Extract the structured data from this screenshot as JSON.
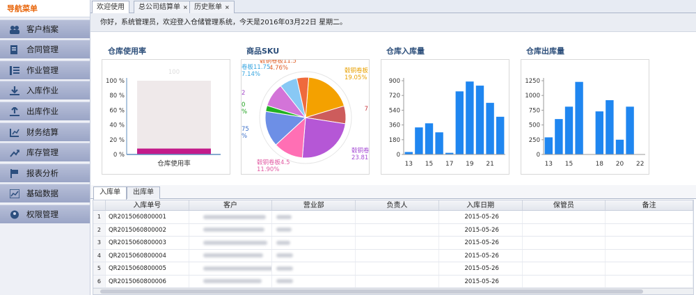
{
  "sidebar": {
    "title": "导航菜单",
    "items": [
      {
        "label": "客户档案",
        "icon": "users-icon"
      },
      {
        "label": "合同管理",
        "icon": "contract-icon"
      },
      {
        "label": "作业管理",
        "icon": "task-list-icon"
      },
      {
        "label": "入库作业",
        "icon": "inbound-icon"
      },
      {
        "label": "出库作业",
        "icon": "outbound-icon"
      },
      {
        "label": "财务结算",
        "icon": "finance-icon"
      },
      {
        "label": "库存管理",
        "icon": "inventory-icon"
      },
      {
        "label": "报表分析",
        "icon": "report-icon"
      },
      {
        "label": "基础数据",
        "icon": "data-icon"
      },
      {
        "label": "权限管理",
        "icon": "permission-icon"
      }
    ]
  },
  "tabs": [
    {
      "label": "欢迎使用",
      "closable": false
    },
    {
      "label": "总公司结算单",
      "closable": true
    },
    {
      "label": "历史账单",
      "closable": true
    }
  ],
  "close_glyph": "×",
  "greeting": "你好，系统管理员，欢迎登入仓储管理系统，今天是2016年03月22日   星期二。",
  "charts": [
    {
      "type": "bar",
      "title": "仓库使用率",
      "xlabel": "仓库使用率",
      "yticks": [
        "100 %",
        "80 %",
        "60 %",
        "40 %",
        "20 %",
        "0 %"
      ],
      "capacity_label": "100",
      "value_pct": 8,
      "bar_color": "#c31b8a"
    },
    {
      "type": "pie",
      "title": "商品SKU",
      "labels": [
        {
          "text": "毂铜卷板",
          "sub": "19.05%",
          "color": "#e8a000"
        },
        {
          "text": "7",
          "sub": "",
          "color": "#c8343c"
        },
        {
          "text": "毂铜卷",
          "sub": "23.81",
          "color": "#a54bd4"
        },
        {
          "text": "毂铜卷板4.5",
          "sub": "11.90%",
          "color": "#e15aa2"
        },
        {
          "text": "75",
          "sub": "%",
          "color": "#3b6fc8"
        },
        {
          "text": "0",
          "sub": "%",
          "color": "#1aa01a"
        },
        {
          "text": "2",
          "sub": "",
          "color": "#a347c7"
        },
        {
          "text": "卷板11.75",
          "sub": "7.14%",
          "color": "#37a5e0"
        },
        {
          "text": "毂铜卷板11.5",
          "sub": "4.76%",
          "color": "#e06028"
        }
      ]
    },
    {
      "type": "bar",
      "title": "仓库入库量",
      "yticks": [
        "900",
        "720",
        "540",
        "360",
        "180",
        "0"
      ],
      "xticks": [
        "13",
        "15",
        "17",
        "19",
        "21"
      ]
    },
    {
      "type": "bar",
      "title": "仓库出库量",
      "yticks": [
        "1250",
        "1000",
        "750",
        "500",
        "250",
        "0"
      ],
      "xticks": [
        "13",
        "15",
        "18",
        "20",
        "22"
      ]
    }
  ],
  "chart_data": [
    {
      "type": "bar",
      "title": "仓库使用率",
      "categories": [
        "仓库使用率"
      ],
      "values": [
        8
      ],
      "ylim": [
        0,
        100
      ],
      "capacity": 100
    },
    {
      "type": "pie",
      "title": "商品SKU",
      "slices": [
        {
          "name": "毂铜卷板",
          "value": 19.05,
          "color": "#f4a100"
        },
        {
          "name": "",
          "value": 7.14,
          "color": "#cd5c5c"
        },
        {
          "name": "毂铜卷",
          "value": 23.81,
          "color": "#b557d6"
        },
        {
          "name": "毂铜卷板4.5",
          "value": 11.9,
          "color": "#ff6fb4"
        },
        {
          "name": "",
          "value": 14.3,
          "color": "#6d8fe6"
        },
        {
          "name": "",
          "value": 2.38,
          "color": "#22b122"
        },
        {
          "name": "",
          "value": 9.52,
          "color": "#d374d8"
        },
        {
          "name": "卷板11.75",
          "value": 7.14,
          "color": "#88c8f4"
        },
        {
          "name": "毂铜卷板11.5",
          "value": 4.76,
          "color": "#ef6a3c"
        }
      ]
    },
    {
      "type": "bar",
      "title": "仓库入库量",
      "x": [
        13,
        14,
        15,
        16,
        17,
        18,
        19,
        20,
        21,
        22
      ],
      "values": [
        30,
        330,
        380,
        270,
        20,
        770,
        890,
        840,
        630,
        460
      ],
      "ylim": [
        0,
        900
      ]
    },
    {
      "type": "bar",
      "title": "仓库出库量",
      "x": [
        13,
        14,
        15,
        16,
        17,
        18,
        19,
        20,
        21,
        22
      ],
      "values": [
        290,
        600,
        810,
        1230,
        0,
        730,
        920,
        250,
        810
      ],
      "ylim": [
        0,
        1250
      ]
    }
  ],
  "bottom_tabs": [
    {
      "label": "入库单",
      "active": true
    },
    {
      "label": "出库单",
      "active": false
    }
  ],
  "table": {
    "columns": [
      "",
      "入库单号",
      "客户",
      "营业部",
      "负责人",
      "入库日期",
      "保管员",
      "备注"
    ],
    "rows": [
      {
        "no": "1",
        "id": "QR2015060800001",
        "date": "2015-05-26"
      },
      {
        "no": "2",
        "id": "QR2015060800002",
        "date": "2015-05-26"
      },
      {
        "no": "3",
        "id": "QR2015060800003",
        "date": "2015-05-26"
      },
      {
        "no": "4",
        "id": "QR2015060800004",
        "date": "2015-05-26"
      },
      {
        "no": "5",
        "id": "QR2015060800005",
        "date": "2015-05-26"
      },
      {
        "no": "6",
        "id": "QR2015060800006",
        "date": "2015-05-26"
      }
    ]
  },
  "colors": {
    "accent": "#e8650a",
    "bar_blue": "#1f86f0",
    "title_blue": "#2c4e7a"
  }
}
